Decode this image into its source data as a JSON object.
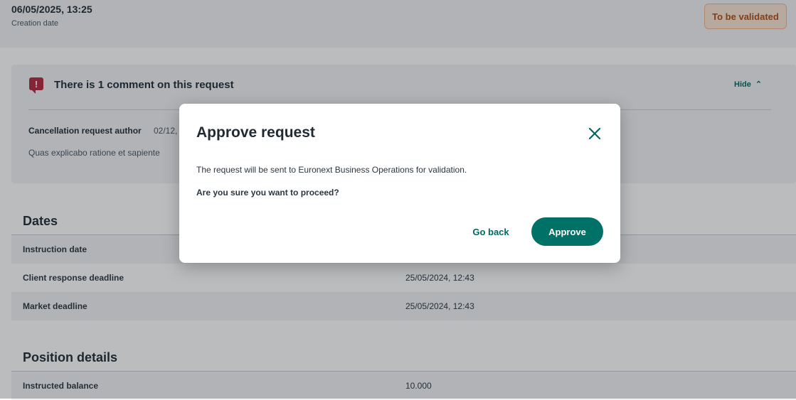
{
  "header": {
    "creation_value": "06/05/2025, 13:25",
    "creation_label": "Creation date",
    "status_badge": "To be validated"
  },
  "comments": {
    "heading": "There is 1 comment on this request",
    "toggle_label": "Hide",
    "author": "Cancellation request author",
    "date_partial": "02/12,",
    "body_partial": "Quas explicabo ratione et sapiente"
  },
  "dates": {
    "title": "Dates",
    "rows": [
      {
        "label": "Instruction date",
        "value": ""
      },
      {
        "label": "Client response deadline",
        "value": "25/05/2024, 12:43"
      },
      {
        "label": "Market deadline",
        "value": "25/05/2024, 12:43"
      }
    ]
  },
  "position_details": {
    "title": "Position details",
    "rows": [
      {
        "label": "Instructed balance",
        "value": "10.000"
      }
    ]
  },
  "modal": {
    "title": "Approve request",
    "message": "The request will be sent to Euronext Business Operations for validation.",
    "question": "Are you sure you want to proceed?",
    "go_back_label": "Go back",
    "approve_label": "Approve"
  },
  "colors": {
    "accent": "#007166",
    "alert": "#b3283b",
    "badge_text": "#b04a12",
    "badge_background": "#fde4d2"
  },
  "icons": [
    "comment-alert-icon",
    "chevron-up-icon",
    "close-icon"
  ]
}
